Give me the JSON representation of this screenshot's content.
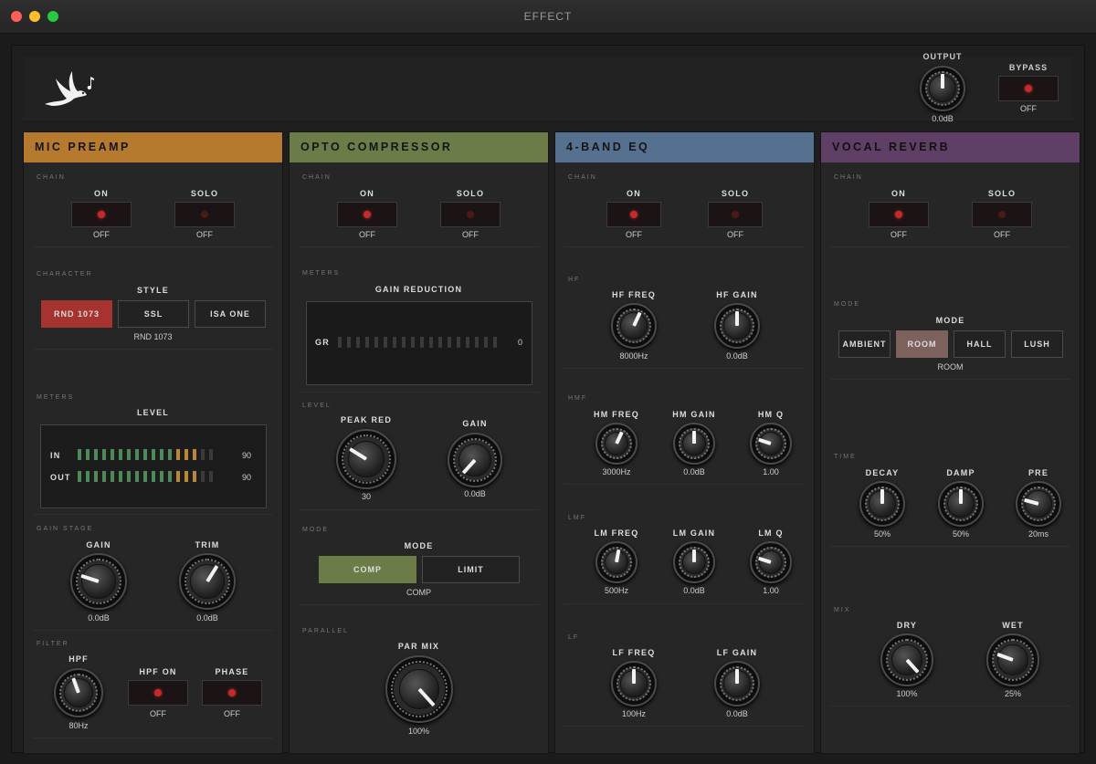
{
  "window": {
    "title": "EFFECT"
  },
  "header": {
    "output": {
      "label": "OUTPUT",
      "value": "0.0dB"
    },
    "bypass": {
      "label": "BYPASS",
      "value": "OFF"
    }
  },
  "common": {
    "chain": "CHAIN",
    "on": "ON",
    "solo": "SOLO",
    "off": "OFF"
  },
  "mic_preamp": {
    "title": "MIC PREAMP",
    "color": "#b67a2f",
    "character": {
      "section": "CHARACTER",
      "label": "STYLE",
      "options": [
        "RND 1073",
        "SSL",
        "ISA ONE"
      ],
      "value": "RND 1073"
    },
    "meters": {
      "section": "METERS",
      "label": "LEVEL",
      "in_label": "IN",
      "in_value": "90",
      "out_label": "OUT",
      "out_value": "90"
    },
    "gain_stage": {
      "section": "GAIN STAGE",
      "gain_label": "GAIN",
      "gain_value": "0.0dB",
      "trim_label": "TRIM",
      "trim_value": "0.0dB"
    },
    "filter": {
      "section": "FILTER",
      "hpf_label": "HPF",
      "hpf_value": "80Hz",
      "hpf_on_label": "HPF ON",
      "hpf_on_value": "OFF",
      "phase_label": "PHASE",
      "phase_value": "OFF"
    }
  },
  "opto_compressor": {
    "title": "OPTO COMPRESSOR",
    "color": "#6b7c48",
    "meters": {
      "section": "METERS",
      "label": "GAIN REDUCTION",
      "gr_label": "GR",
      "gr_value": "0"
    },
    "level": {
      "section": "LEVEL",
      "peak_red_label": "PEAK RED",
      "peak_red_value": "30",
      "gain_label": "GAIN",
      "gain_value": "0.0dB"
    },
    "mode": {
      "section": "MODE",
      "label": "MODE",
      "options": [
        "COMP",
        "LIMIT"
      ],
      "value": "COMP"
    },
    "parallel": {
      "section": "PARALLEL",
      "label": "PAR MIX",
      "value": "100%"
    }
  },
  "eq": {
    "title": "4-BAND EQ",
    "color": "#56708f",
    "hf": {
      "section": "HF",
      "freq_label": "HF FREQ",
      "freq_value": "8000Hz",
      "gain_label": "HF GAIN",
      "gain_value": "0.0dB"
    },
    "hmf": {
      "section": "HMF",
      "freq_label": "HM FREQ",
      "freq_value": "3000Hz",
      "gain_label": "HM GAIN",
      "gain_value": "0.0dB",
      "q_label": "HM Q",
      "q_value": "1.00"
    },
    "lmf": {
      "section": "LMF",
      "freq_label": "LM FREQ",
      "freq_value": "500Hz",
      "gain_label": "LM GAIN",
      "gain_value": "0.0dB",
      "q_label": "LM Q",
      "q_value": "1.00"
    },
    "lf": {
      "section": "LF",
      "freq_label": "LF FREQ",
      "freq_value": "100Hz",
      "gain_label": "LF GAIN",
      "gain_value": "0.0dB"
    }
  },
  "vocal_reverb": {
    "title": "VOCAL REVERB",
    "color": "#5f3f66",
    "mode": {
      "section": "MODE",
      "label": "MODE",
      "options": [
        "AMBIENT",
        "ROOM",
        "HALL",
        "LUSH"
      ],
      "value": "ROOM"
    },
    "time": {
      "section": "TIME",
      "decay_label": "DECAY",
      "decay_value": "50%",
      "damp_label": "DAMP",
      "damp_value": "50%",
      "pre_label": "PRE",
      "pre_value": "20ms"
    },
    "mix": {
      "section": "MIX",
      "dry_label": "DRY",
      "dry_value": "100%",
      "wet_label": "WET",
      "wet_value": "25%"
    }
  },
  "colors": {
    "active_red": "#a6332f",
    "active_green": "#6b7c48",
    "active_room": "#7d615d",
    "led": "#c42a2a"
  }
}
